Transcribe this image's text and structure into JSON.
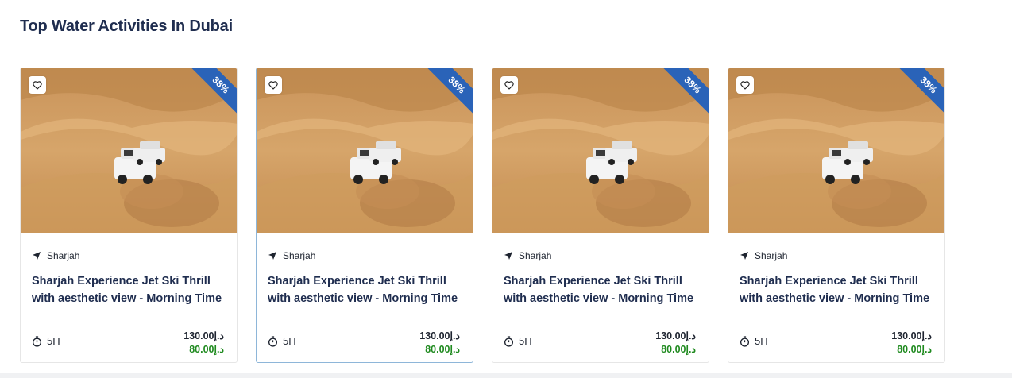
{
  "section": {
    "title": "Top Water Activities In Dubai"
  },
  "cards": [
    {
      "discount": "38%",
      "location": "Sharjah",
      "title": "Sharjah Experience Jet Ski Thrill with aesthetic view - Morning Time",
      "duration": "5H",
      "old_price": "130.00د.إ",
      "new_price": "80.00د.إ"
    },
    {
      "discount": "38%",
      "location": "Sharjah",
      "title": "Sharjah Experience Jet Ski Thrill with aesthetic view - Morning Time",
      "duration": "5H",
      "old_price": "130.00د.إ",
      "new_price": "80.00د.إ"
    },
    {
      "discount": "38%",
      "location": "Sharjah",
      "title": "Sharjah Experience Jet Ski Thrill with aesthetic view - Morning Time",
      "duration": "5H",
      "old_price": "130.00د.إ",
      "new_price": "80.00د.إ"
    },
    {
      "discount": "38%",
      "location": "Sharjah",
      "title": "Sharjah Experience Jet Ski Thrill with aesthetic view - Morning Time",
      "duration": "5H",
      "old_price": "130.00د.إ",
      "new_price": "80.00د.إ"
    }
  ],
  "icons": {
    "favorite": "heart-icon",
    "location": "send-arrow-icon",
    "duration": "stopwatch-icon"
  },
  "colors": {
    "title": "#1f2d4f",
    "ribbon": "#2a63b8",
    "new_price": "#1f8a1f",
    "active_border": "#8eb6d9"
  }
}
